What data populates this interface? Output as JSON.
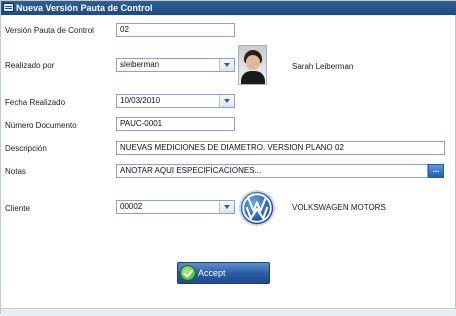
{
  "window": {
    "title": "Nueva Versión Pauta de Control"
  },
  "form": {
    "version_label": "Versión Pauta de Control",
    "version_value": "02",
    "realizado_label": "Realizado por",
    "realizado_value": "sleiberman",
    "realizado_name": "Sarah Leiberman",
    "fecha_label": "Fecha Realizado",
    "fecha_value": "10/03/2010",
    "numero_label": "Número Documento",
    "numero_value": "PAUC-0001",
    "descripcion_label": "Descripción",
    "descripcion_value": "NUEVAS MEDICIONES DE DIAMETRO. VERSION PLANO 02",
    "notas_label": "Notas",
    "notas_value": "ANOTAR AQUI ESPECIFICACIONES...",
    "notas_button": "...",
    "cliente_label": "Cliente",
    "cliente_value": "00002",
    "cliente_name": "VOLKSWAGEN MOTORS",
    "cliente_logo_text": "VW"
  },
  "actions": {
    "accept_label": "Accept"
  },
  "icons": {
    "window_icon": "window-app-icon",
    "combo_arrow": "chevron-down-icon",
    "accept_icon": "check-icon",
    "avatar": "user-photo",
    "client_logo": "volkswagen-logo"
  },
  "colors": {
    "titlebar": "#2a5690",
    "field_border": "#8ea3bf",
    "button_blue": "#2a5aa1",
    "check_green": "#36a12c"
  }
}
